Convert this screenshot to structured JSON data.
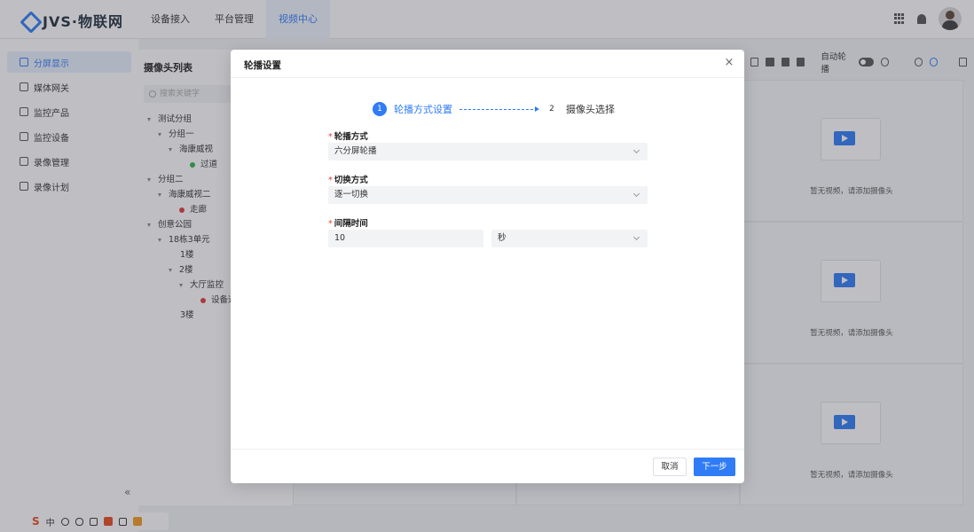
{
  "app": {
    "logo_text": "JVS·物联网",
    "nav": [
      {
        "label": "设备接入"
      },
      {
        "label": "平台管理"
      },
      {
        "label": "视频中心"
      }
    ]
  },
  "sidebar": {
    "items": [
      {
        "label": "分屏显示",
        "active": true
      },
      {
        "label": "媒体网关"
      },
      {
        "label": "监控产品"
      },
      {
        "label": "监控设备"
      },
      {
        "label": "录像管理"
      },
      {
        "label": "录像计划"
      }
    ],
    "collapse_glyph": "«"
  },
  "tree": {
    "title": "摄像头列表",
    "search_placeholder": "搜索关键字",
    "nodes": [
      {
        "label": "测试分组"
      },
      {
        "label": "分组一"
      },
      {
        "label": "海康威视"
      },
      {
        "label": "过道"
      },
      {
        "label": "分组二"
      },
      {
        "label": "海康威视二"
      },
      {
        "label": "走廊"
      },
      {
        "label": "创意公园"
      },
      {
        "label": "18栋3单元"
      },
      {
        "label": "1楼"
      },
      {
        "label": "2楼"
      },
      {
        "label": "大厅监控"
      },
      {
        "label": "设备道"
      },
      {
        "label": "3楼"
      }
    ]
  },
  "video": {
    "auto_rotate_label": "自动轮播",
    "empty_text": "暂无视频，请添加摄像头"
  },
  "dialog": {
    "title": "轮播设置",
    "close_glyph": "×",
    "steps": [
      {
        "num": "1",
        "label": "轮播方式设置"
      },
      {
        "num": "2",
        "label": "摄像头选择"
      }
    ],
    "fields": {
      "mode": {
        "label": "轮播方式",
        "value": "六分屏轮播"
      },
      "switch": {
        "label": "切换方式",
        "value": "逐一切换"
      },
      "interval": {
        "label": "间隔时间",
        "value": "10",
        "unit": "秒"
      }
    },
    "cancel_label": "取消",
    "next_label": "下一步"
  },
  "ime": {
    "s": "S",
    "zh": "中"
  }
}
